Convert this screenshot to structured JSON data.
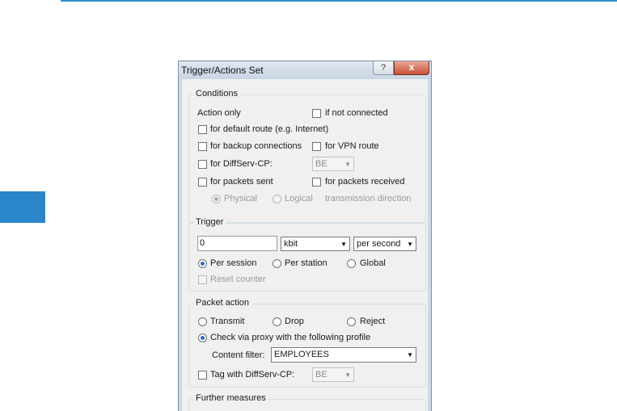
{
  "dialog": {
    "title": "Trigger/Actions Set",
    "help_label": "?",
    "close_label": "x"
  },
  "conditions": {
    "legend": "Conditions",
    "action_only": "Action only",
    "if_not_connected": "if not connected",
    "default_route": "for default route (e.g. Internet)",
    "backup_connections": "for backup connections",
    "vpn_route": "for VPN route",
    "diffserv_cp": "for DiffServ-CP:",
    "diffserv_value": "BE",
    "packets_sent": "for packets sent",
    "packets_received": "for packets received",
    "physical": "Physical",
    "logical": "Logical",
    "transmission_direction": "transmission direction"
  },
  "trigger": {
    "legend": "Trigger",
    "value": "0",
    "unit": "kbit",
    "period": "per second",
    "per_session": "Per session",
    "per_station": "Per station",
    "global": "Global",
    "reset_counter": "Reset counter"
  },
  "packet_action": {
    "legend": "Packet action",
    "transmit": "Transmit",
    "drop": "Drop",
    "reject": "Reject",
    "check_via_proxy": "Check via proxy with the following profile",
    "content_filter_label": "Content filter:",
    "content_filter_value": "EMPLOYEES",
    "tag_diffserv": "Tag with DiffServ-CP:",
    "tag_diffserv_value": "BE"
  },
  "further_measures": {
    "legend": "Further measures"
  },
  "colors": {
    "accent": "#2a86c8",
    "rule": "#2f8fd0",
    "close_button": "#c9513a"
  }
}
